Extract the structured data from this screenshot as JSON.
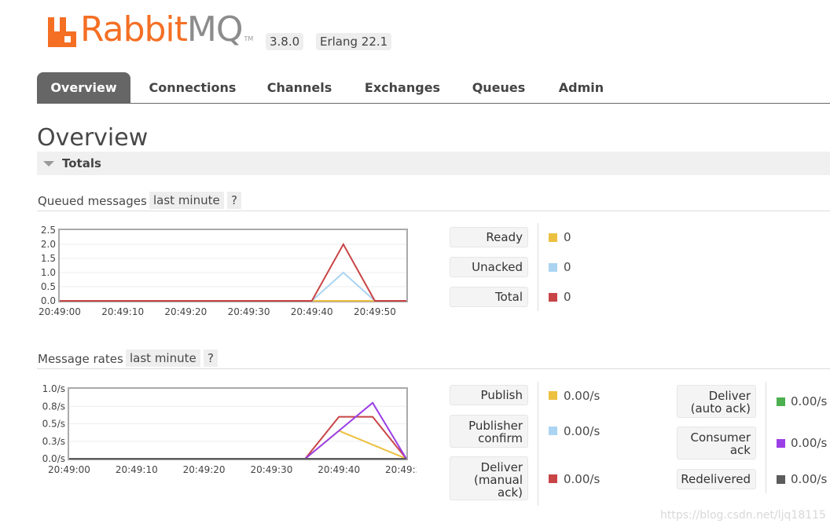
{
  "header": {
    "logo_text": "Rabbit",
    "logo_text_mq": "MQ",
    "logo_tm": "TM",
    "version": "3.8.0",
    "erlang": "Erlang 22.1"
  },
  "nav": {
    "tabs": [
      {
        "label": "Overview",
        "active": true
      },
      {
        "label": "Connections",
        "active": false
      },
      {
        "label": "Channels",
        "active": false
      },
      {
        "label": "Exchanges",
        "active": false
      },
      {
        "label": "Queues",
        "active": false
      },
      {
        "label": "Admin",
        "active": false
      }
    ]
  },
  "page": {
    "title": "Overview",
    "section": "Totals"
  },
  "queued": {
    "label": "Queued messages",
    "range": "last minute",
    "help": "?",
    "legend": [
      {
        "label": "Ready",
        "value": "0",
        "color": "#ecc040"
      },
      {
        "label": "Unacked",
        "value": "0",
        "color": "#aad4f2"
      },
      {
        "label": "Total",
        "value": "0",
        "color": "#c84446"
      }
    ]
  },
  "rates": {
    "label": "Message rates",
    "range": "last minute",
    "help": "?",
    "legend_left": [
      {
        "label": [
          "Publish"
        ],
        "value": "0.00/s",
        "color": "#ecc040"
      },
      {
        "label": [
          "Publisher",
          "confirm"
        ],
        "value": "0.00/s",
        "color": "#aad4f2"
      },
      {
        "label": [
          "Deliver",
          "(manual",
          "ack)"
        ],
        "value": "0.00/s",
        "color": "#c84446"
      }
    ],
    "legend_right": [
      {
        "label": [
          "Deliver",
          "(auto ack)"
        ],
        "value": "0.00/s",
        "color": "#4caf50"
      },
      {
        "label": [
          "Consumer",
          "ack"
        ],
        "value": "0.00/s",
        "color": "#9b3fe6"
      },
      {
        "label": [
          "Redelivered"
        ],
        "value": "0.00/s",
        "color": "#5c5c5c"
      }
    ]
  },
  "chart_data": [
    {
      "type": "line",
      "title": "Queued messages",
      "x": [
        "20:49:00",
        "20:49:05",
        "20:49:10",
        "20:49:15",
        "20:49:20",
        "20:49:25",
        "20:49:30",
        "20:49:35",
        "20:49:40",
        "20:49:45",
        "20:49:50",
        "20:49:55"
      ],
      "xticks": [
        "20:49:00",
        "20:49:10",
        "20:49:20",
        "20:49:30",
        "20:49:40",
        "20:49:50"
      ],
      "yticks": [
        "0.0",
        "0.5",
        "1.0",
        "1.5",
        "2.0",
        "2.5"
      ],
      "ylim": [
        0,
        2.5
      ],
      "series": [
        {
          "name": "Ready",
          "color": "#ecc040",
          "values": [
            0,
            0,
            0,
            0,
            0,
            0,
            0,
            0,
            0,
            0,
            0,
            0
          ]
        },
        {
          "name": "Unacked",
          "color": "#aad4f2",
          "values": [
            0,
            0,
            0,
            0,
            0,
            0,
            0,
            0,
            0,
            1,
            0,
            0
          ]
        },
        {
          "name": "Total",
          "color": "#c84446",
          "values": [
            0,
            0,
            0,
            0,
            0,
            0,
            0,
            0,
            0,
            2,
            0,
            0
          ]
        }
      ]
    },
    {
      "type": "line",
      "title": "Message rates",
      "x": [
        "20:49:00",
        "20:49:05",
        "20:49:10",
        "20:49:15",
        "20:49:20",
        "20:49:25",
        "20:49:30",
        "20:49:35",
        "20:49:40",
        "20:49:45",
        "20:49:50"
      ],
      "xticks": [
        "20:49:00",
        "20:49:10",
        "20:49:20",
        "20:49:30",
        "20:49:40",
        "20:49:50"
      ],
      "yticks": [
        "0.0/s",
        "0.3/s",
        "0.5/s",
        "0.8/s",
        "1.0/s"
      ],
      "ylim": [
        0,
        1.0
      ],
      "series": [
        {
          "name": "Publish",
          "color": "#ecc040",
          "values": [
            0,
            0,
            0,
            0,
            0,
            0,
            0,
            0,
            0.4,
            0.2,
            0
          ]
        },
        {
          "name": "Publisher confirm",
          "color": "#aad4f2",
          "values": [
            0,
            0,
            0,
            0,
            0,
            0,
            0,
            0,
            0,
            0,
            0
          ]
        },
        {
          "name": "Deliver (manual ack)",
          "color": "#c84446",
          "values": [
            0,
            0,
            0,
            0,
            0,
            0,
            0,
            0,
            0.6,
            0.6,
            0
          ]
        },
        {
          "name": "Deliver (auto ack)",
          "color": "#4caf50",
          "values": [
            0,
            0,
            0,
            0,
            0,
            0,
            0,
            0,
            0,
            0,
            0
          ]
        },
        {
          "name": "Consumer ack",
          "color": "#9b3fe6",
          "values": [
            0,
            0,
            0,
            0,
            0,
            0,
            0,
            0,
            0.4,
            0.8,
            0
          ]
        },
        {
          "name": "Redelivered",
          "color": "#5c5c5c",
          "values": [
            0,
            0,
            0,
            0,
            0,
            0,
            0,
            0,
            0,
            0,
            0
          ]
        }
      ]
    }
  ],
  "watermark": "https://blog.csdn.net/ljq18115"
}
